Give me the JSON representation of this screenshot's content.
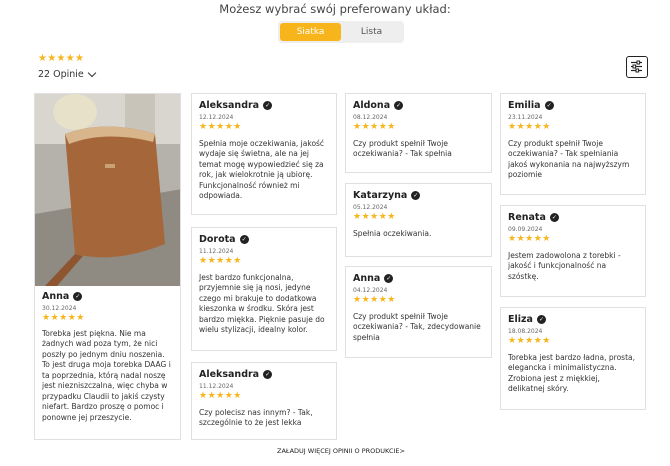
{
  "header": {
    "title": "Możesz wybrać swój preferowany układ:"
  },
  "layout_toggle": {
    "options": [
      "Siatka",
      "Lista"
    ],
    "selected": "Siatka"
  },
  "summary": {
    "stars": "★★★★★",
    "count_label": "22 Opinie"
  },
  "colors": {
    "accent": "#f8b51b",
    "text": "#333333",
    "border": "#e0e0e0"
  },
  "reviews": [
    {
      "name": "Anna",
      "date": "30.12.2024",
      "stars": "★★★★★",
      "text": "Torebka jest piękna. Nie ma żadnych wad poza tym, że nici poszły po jednym dniu noszenia. To jest druga moja torebka DAAG i ta poprzednia, którą nadal noszę jest niezniszczalna, więc chyba w przypadku Claudii to jakiś czysty niefart. Bardzo proszę o pomoc i ponowne jej przeszycie."
    },
    {
      "name": "Aleksandra",
      "date": "12.12.2024",
      "stars": "★★★★★",
      "text": "Spełnia moje oczekiwania, jakość wydaje się świetna, ale na jej temat mogę wypowiedzieć się za rok, jak wielokrotnie ją ubiorę. Funkcjonalność również mi odpowiada."
    },
    {
      "name": "Dorota",
      "date": "11.12.2024",
      "stars": "★★★★★",
      "text": "Jest bardzo funkcjonalna, przyjemnie się ją nosi, jedyne czego mi brakuje to dodatkowa kieszonka w środku. Skóra jest bardzo miękka. Pięknie pasuje do wielu stylizacji, idealny kolor."
    },
    {
      "name": "Aleksandra",
      "date": "11.12.2024",
      "stars": "★★★★★",
      "text": "Czy polecisz nas innym? - Tak, szczególnie to że jest lekka"
    },
    {
      "name": "Aldona",
      "date": "08.12.2024",
      "stars": "★★★★★",
      "text": "Czy produkt spełnił Twoje oczekiwania? - Tak spełnia"
    },
    {
      "name": "Katarzyna",
      "date": "05.12.2024",
      "stars": "★★★★★",
      "text": "Spełnia oczekiwania."
    },
    {
      "name": "Anna",
      "date": "04.12.2024",
      "stars": "★★★★★",
      "text": "Czy produkt spełnił Twoje oczekiwania? - Tak, zdecydowanie spełnia"
    },
    {
      "name": "Emilia",
      "date": "23.11.2024",
      "stars": "★★★★★",
      "text": "Czy produkt spełnił Twoje oczekiwania? - Tak spełniania jakoś wykonania na najwyższym poziomie"
    },
    {
      "name": "Renata",
      "date": "09.09.2024",
      "stars": "★★★★★",
      "text": "Jestem zadowolona z torebki - jakość i funkcjonalność na szóstkę."
    },
    {
      "name": "Eliza",
      "date": "18.08.2024",
      "stars": "★★★★★",
      "text": "Torebka jest bardzo ładna, prosta, elegancka i minimalistyczna. Zrobiona jest z miękkiej, delikatnej skóry."
    }
  ],
  "load_more": "ZAŁADUJ WIĘCEJ OPINII O PRODUKCIE>"
}
